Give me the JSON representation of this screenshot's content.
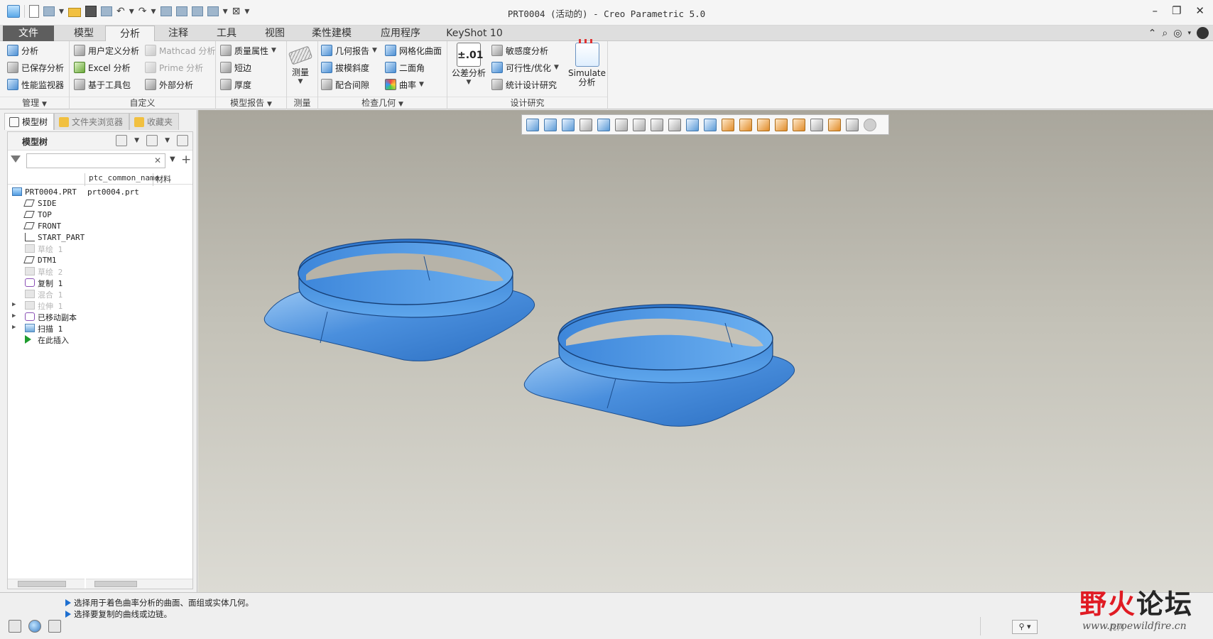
{
  "window": {
    "title": "PRT0004 (活动的) - Creo Parametric 5.0",
    "controls": [
      "–",
      "❐",
      "✕"
    ]
  },
  "menu": {
    "tabs": [
      "文件",
      "模型",
      "分析",
      "注释",
      "工具",
      "视图",
      "柔性建模",
      "应用程序",
      "KeyShot 10"
    ],
    "active": "分析"
  },
  "ribbon": {
    "groups": {
      "manage": {
        "label": "管理",
        "items": [
          "分析",
          "已保存分析",
          "性能监视器"
        ]
      },
      "custom": {
        "label": "自定义",
        "items": [
          "用户定义分析",
          "Excel 分析",
          "基于工具包",
          "Mathcad 分析",
          "Prime 分析",
          "外部分析"
        ]
      },
      "model_report": {
        "label": "模型报告",
        "items": [
          "质量属性",
          "短边",
          "厚度"
        ]
      },
      "measure": {
        "label": "测量",
        "button": "测量"
      },
      "inspect_geometry": {
        "label": "检查几何",
        "items": [
          "几何报告",
          "拔模斜度",
          "配合间隙",
          "网格化曲面",
          "二面角",
          "曲率"
        ]
      },
      "design_study": {
        "label": "设计研究",
        "tolerance_icon": "±.01",
        "tolerance_button": "公差分析",
        "items": [
          "敏感度分析",
          "可行性/优化",
          "统计设计研究"
        ],
        "simulate_line1": "Simulate",
        "simulate_line2": "分析"
      }
    }
  },
  "left_panel": {
    "tabs": [
      "模型树",
      "文件夹浏览器",
      "收藏夹"
    ],
    "tree_title": "模型树",
    "search": {
      "value": "",
      "placeholder": ""
    },
    "columns": [
      "ptc_common_name",
      "材料"
    ],
    "tree": [
      {
        "label": "PRT0004.PRT",
        "value": "prt0004.prt",
        "icon": "part-icon",
        "dim": false,
        "expander": ""
      },
      {
        "label": "SIDE",
        "value": "",
        "icon": "datum-plane-icon",
        "dim": false,
        "expander": ""
      },
      {
        "label": "TOP",
        "value": "",
        "icon": "datum-plane-icon",
        "dim": false,
        "expander": ""
      },
      {
        "label": "FRONT",
        "value": "",
        "icon": "datum-plane-icon",
        "dim": false,
        "expander": ""
      },
      {
        "label": "START_PART",
        "value": "",
        "icon": "csys-icon",
        "dim": false,
        "expander": ""
      },
      {
        "label": "草绘 1",
        "value": "",
        "icon": "sketch-icon",
        "dim": true,
        "expander": ""
      },
      {
        "label": "DTM1",
        "value": "",
        "icon": "datum-plane-icon",
        "dim": false,
        "expander": ""
      },
      {
        "label": "草绘 2",
        "value": "",
        "icon": "sketch-icon",
        "dim": true,
        "expander": ""
      },
      {
        "label": "复制 1",
        "value": "",
        "icon": "copy-icon",
        "dim": false,
        "expander": ""
      },
      {
        "label": "混合 1",
        "value": "",
        "icon": "blend-icon",
        "dim": true,
        "expander": ""
      },
      {
        "label": "拉伸 1",
        "value": "",
        "icon": "extrude-icon",
        "dim": true,
        "expander": "▶"
      },
      {
        "label": "已移动副本",
        "value": "",
        "icon": "moved-copy-icon",
        "dim": false,
        "expander": "▶"
      },
      {
        "label": "扫描 1",
        "value": "",
        "icon": "sweep-icon",
        "dim": false,
        "expander": "▶"
      },
      {
        "label": "在此插入",
        "value": "",
        "icon": "insert-here-icon",
        "dim": false,
        "expander": ""
      }
    ]
  },
  "status": {
    "messages": [
      "选择用于着色曲率分析的曲面、面组或实体几何。",
      "选择要复制的曲线或边链。"
    ],
    "filter_label": "几何"
  },
  "watermark": {
    "text_red": "野火",
    "text_dark": "论坛",
    "url": "www.proewildfire.cn"
  },
  "colors": {
    "model_blue": "#4c92e0",
    "viewport_top": "#a9a69c",
    "viewport_bottom": "#dcdbd4",
    "file_tab": "#5e5e5e"
  }
}
